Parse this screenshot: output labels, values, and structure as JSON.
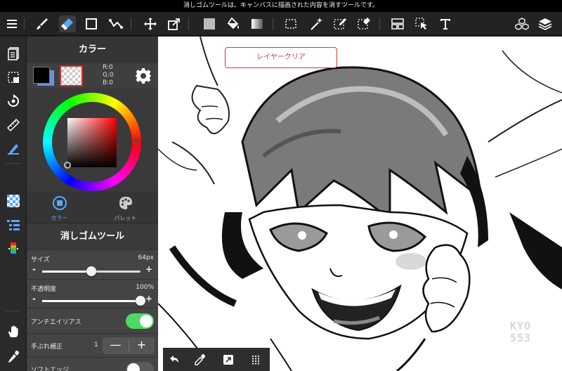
{
  "hint": "消しゴムツールは、キャンバスに描画された内容を消すツールです。",
  "toolbar": {
    "items": [
      "menu",
      "brush",
      "eraser",
      "rect-select",
      "vector-line",
      "move",
      "transform",
      "fill-color",
      "bucket",
      "gradient",
      "select-rect",
      "magic-wand",
      "select-pen",
      "select-erase",
      "layout",
      "operation",
      "text",
      "3d",
      "layers"
    ]
  },
  "color_panel": {
    "title": "カラー",
    "rgb": {
      "r": "R:0",
      "g": "G:0",
      "b": "B:0"
    },
    "tabs": [
      {
        "label": "カラー",
        "active": true
      },
      {
        "label": "パレット",
        "active": false
      }
    ]
  },
  "tool_panel": {
    "title": "消しゴムツール",
    "size": {
      "label": "サイズ",
      "value": "64px",
      "level": 0.5
    },
    "opacity": {
      "label": "不透明度",
      "value": "100%",
      "level": 1.0
    },
    "antialias": {
      "label": "アンチエイリアス",
      "on": true
    },
    "stabilizer": {
      "label": "手ぶれ補正",
      "value": "1",
      "minus": "—",
      "plus": "+"
    },
    "soft_edge": {
      "label": "ソフトエッジ",
      "on": false
    }
  },
  "canvas": {
    "clear_layer_button": "レイヤークリア",
    "watermark": [
      "KYO",
      "553"
    ]
  },
  "colors": {
    "accent_green": "#4cd964",
    "accent_red": "#d23b3b",
    "icon_blue": "#5aa7ff"
  }
}
